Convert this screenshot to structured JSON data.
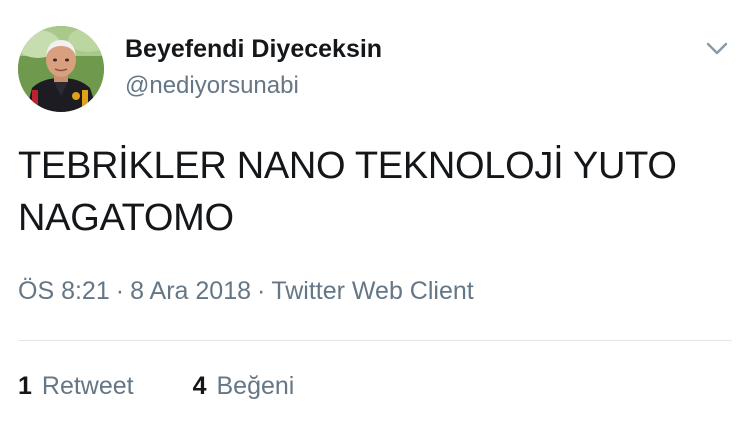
{
  "author": {
    "display_name": "Beyefendi Diyeceksin",
    "handle": "@nediyorsunabi"
  },
  "tweet": {
    "text": "TEBRİKLER NANO TEKNOLOJİ YUTO NAGATOMO"
  },
  "meta": {
    "time": "ÖS 8:21",
    "separator": "·",
    "date": "8 Ara 2018",
    "client": "Twitter Web Client"
  },
  "stats": {
    "retweet_count": "1",
    "retweet_label": "Retweet",
    "like_count": "4",
    "like_label": "Beğeni"
  },
  "icons": {
    "menu": "chevron-down-icon"
  },
  "colors": {
    "text_primary": "#14171a",
    "text_secondary": "#657786",
    "divider": "#e1e8ed",
    "chevron": "#8899a6"
  }
}
